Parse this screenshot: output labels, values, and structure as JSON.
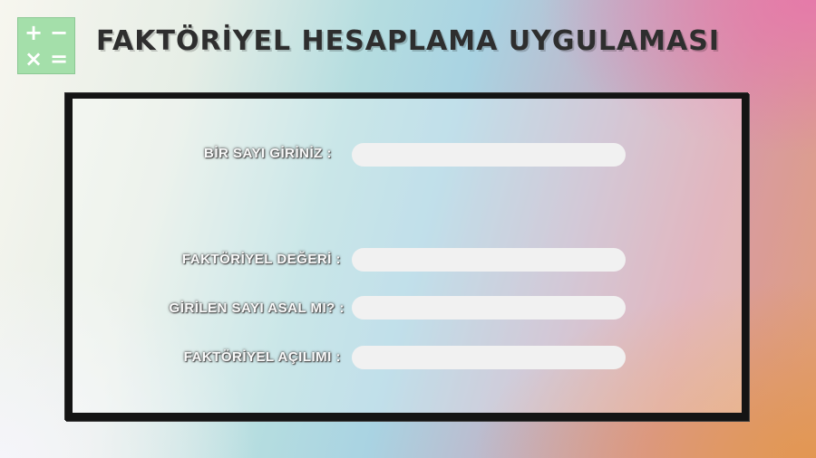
{
  "app": {
    "title": "FAKTÖRİYEL HESAPLAMA UYGULAMASI"
  },
  "logo": {
    "icon": "calculator-icon",
    "symbols": [
      "+",
      "−",
      "×",
      "="
    ],
    "color": "#a4dfaa"
  },
  "form": {
    "input_label": "BİR SAYI GİRİNİZ :",
    "input_value": "",
    "input_placeholder": ""
  },
  "results": {
    "factorial_label": "FAKTÖRİYEL DEĞERİ :",
    "factorial_value": "",
    "prime_label": "GİRİLEN SAYI ASAL MI? :",
    "prime_value": "",
    "expansion_label": "FAKTÖRİYEL AÇILIMI :",
    "expansion_value": ""
  }
}
